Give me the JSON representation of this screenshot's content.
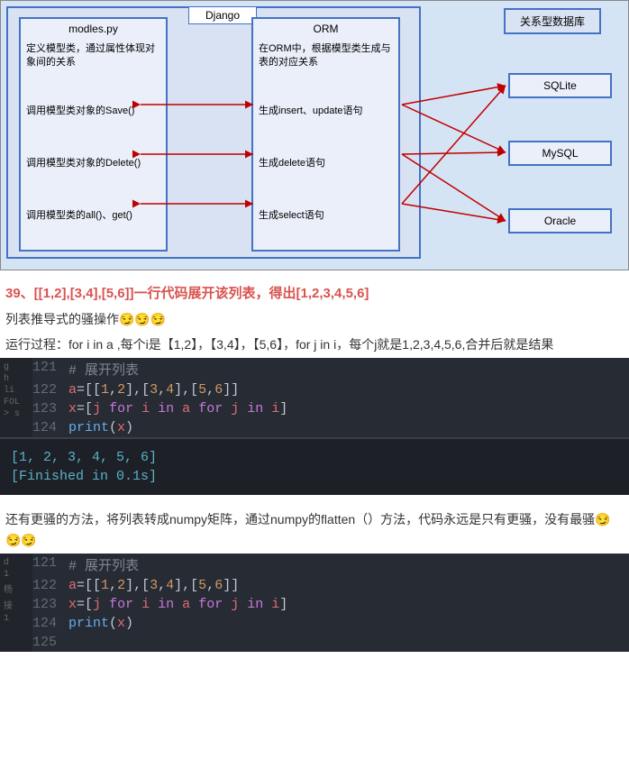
{
  "diagram": {
    "django_label": "Django",
    "models_title": "modles.py",
    "models_desc": "定义模型类，通过属性体现对象间的关系",
    "models_items": [
      "调用模型类对象的Save()",
      "调用模型类对象的Delete()",
      "调用模型类的all()、get()"
    ],
    "orm_title": "ORM",
    "orm_desc": "在ORM中，根据模型类生成与表的对应关系",
    "orm_items": [
      "生成insert、update语句",
      "生成delete语句",
      "生成select语句"
    ],
    "db_label": "关系型数据库",
    "db_items": [
      "SQLite",
      "MySQL",
      "Oracle"
    ]
  },
  "heading": "39、[[1,2],[3,4],[5,6]]一行代码展开该列表，得出[1,2,3,4,5,6]",
  "para1_a": "列表推导式的骚操作",
  "emoji1": "😏😏😏",
  "para2": "运行过程：for i in a ,每个i是【1,2】，【3,4】，【5,6】，for j in i，每个j就是1,2,3,4,5,6,合并后就是结果",
  "code1": {
    "sidebar": [
      "g",
      "h",
      "li",
      "FOL",
      "> s"
    ],
    "lines": [
      {
        "n": "121",
        "parts": [
          {
            "c": "comment",
            "t": "# 展开列表"
          }
        ]
      },
      {
        "n": "122",
        "parts": [
          {
            "c": "var",
            "t": "a"
          },
          {
            "c": "op",
            "t": "=[["
          },
          {
            "c": "num",
            "t": "1"
          },
          {
            "c": "op",
            "t": ","
          },
          {
            "c": "num",
            "t": "2"
          },
          {
            "c": "op",
            "t": "],["
          },
          {
            "c": "num",
            "t": "3"
          },
          {
            "c": "op",
            "t": ","
          },
          {
            "c": "num",
            "t": "4"
          },
          {
            "c": "op",
            "t": "],["
          },
          {
            "c": "num",
            "t": "5"
          },
          {
            "c": "op",
            "t": ","
          },
          {
            "c": "num",
            "t": "6"
          },
          {
            "c": "op",
            "t": "]]"
          }
        ]
      },
      {
        "n": "123",
        "parts": [
          {
            "c": "var",
            "t": "x"
          },
          {
            "c": "op",
            "t": "=["
          },
          {
            "c": "var",
            "t": "j"
          },
          {
            "c": "op",
            "t": " "
          },
          {
            "c": "kw",
            "t": "for"
          },
          {
            "c": "op",
            "t": " "
          },
          {
            "c": "var",
            "t": "i"
          },
          {
            "c": "op",
            "t": " "
          },
          {
            "c": "kw",
            "t": "in"
          },
          {
            "c": "op",
            "t": " "
          },
          {
            "c": "var",
            "t": "a"
          },
          {
            "c": "op",
            "t": " "
          },
          {
            "c": "kw",
            "t": "for"
          },
          {
            "c": "op",
            "t": " "
          },
          {
            "c": "var",
            "t": "j"
          },
          {
            "c": "op",
            "t": " "
          },
          {
            "c": "kw",
            "t": "in"
          },
          {
            "c": "op",
            "t": " "
          },
          {
            "c": "var",
            "t": "i"
          },
          {
            "c": "op",
            "t": "]"
          }
        ]
      },
      {
        "n": "124",
        "parts": [
          {
            "c": "fn",
            "t": "print"
          },
          {
            "c": "op",
            "t": "("
          },
          {
            "c": "var",
            "t": "x"
          },
          {
            "c": "op",
            "t": ")"
          }
        ]
      }
    ]
  },
  "output1": "[1, 2, 3, 4, 5, 6]\n[Finished in 0.1s]",
  "para3_a": "还有更骚的方法，将列表转成numpy矩阵，通过numpy的flatten（）方法，代码永远是只有更骚，没有最骚",
  "emoji2": "😏😏😏",
  "code2": {
    "sidebar": [
      "d",
      "1",
      "杨",
      "接",
      "1"
    ],
    "lines": [
      {
        "n": "121",
        "parts": [
          {
            "c": "comment",
            "t": "# 展开列表"
          }
        ]
      },
      {
        "n": "122",
        "parts": [
          {
            "c": "var",
            "t": "a"
          },
          {
            "c": "op",
            "t": "=[["
          },
          {
            "c": "num",
            "t": "1"
          },
          {
            "c": "op",
            "t": ","
          },
          {
            "c": "num",
            "t": "2"
          },
          {
            "c": "op",
            "t": "],["
          },
          {
            "c": "num",
            "t": "3"
          },
          {
            "c": "op",
            "t": ","
          },
          {
            "c": "num",
            "t": "4"
          },
          {
            "c": "op",
            "t": "],["
          },
          {
            "c": "num",
            "t": "5"
          },
          {
            "c": "op",
            "t": ","
          },
          {
            "c": "num",
            "t": "6"
          },
          {
            "c": "op",
            "t": "]]"
          }
        ]
      },
      {
        "n": "123",
        "parts": [
          {
            "c": "var",
            "t": "x"
          },
          {
            "c": "op",
            "t": "=["
          },
          {
            "c": "var",
            "t": "j"
          },
          {
            "c": "op",
            "t": " "
          },
          {
            "c": "kw",
            "t": "for"
          },
          {
            "c": "op",
            "t": " "
          },
          {
            "c": "var",
            "t": "i"
          },
          {
            "c": "op",
            "t": " "
          },
          {
            "c": "kw",
            "t": "in"
          },
          {
            "c": "op",
            "t": " "
          },
          {
            "c": "var",
            "t": "a"
          },
          {
            "c": "op",
            "t": " "
          },
          {
            "c": "kw",
            "t": "for"
          },
          {
            "c": "op",
            "t": " "
          },
          {
            "c": "var",
            "t": "j"
          },
          {
            "c": "op",
            "t": " "
          },
          {
            "c": "kw",
            "t": "in"
          },
          {
            "c": "op",
            "t": " "
          },
          {
            "c": "var",
            "t": "i"
          },
          {
            "c": "op",
            "t": "]"
          }
        ]
      },
      {
        "n": "124",
        "parts": [
          {
            "c": "fn",
            "t": "print"
          },
          {
            "c": "op",
            "t": "("
          },
          {
            "c": "var",
            "t": "x"
          },
          {
            "c": "op",
            "t": ")"
          }
        ]
      },
      {
        "n": "125",
        "parts": []
      }
    ]
  }
}
